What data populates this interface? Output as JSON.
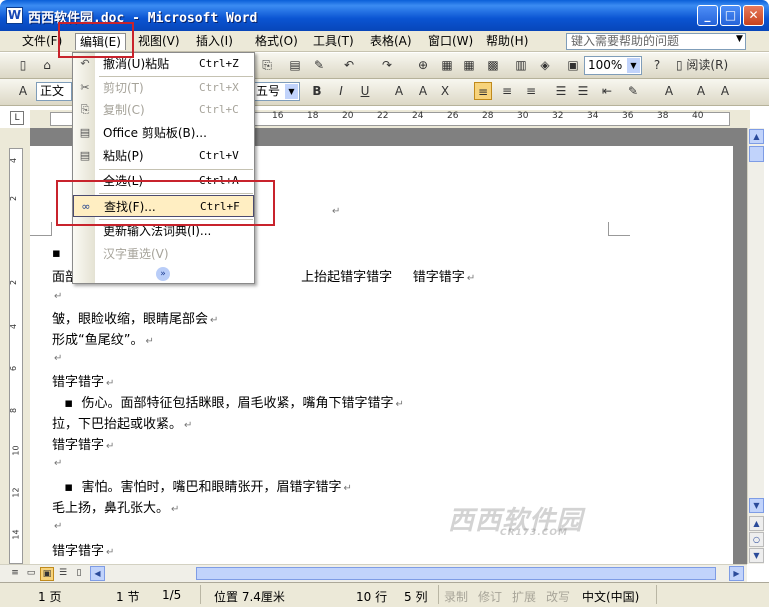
{
  "window": {
    "title": "西西软件园.doc - Microsoft Word",
    "app_icon_letter": "W"
  },
  "window_controls": {
    "minimize": "_",
    "maximize": "□",
    "close": "✕"
  },
  "menubar": {
    "items": [
      "文件(F)",
      "编辑(E)",
      "视图(V)",
      "插入(I)",
      "格式(O)",
      "工具(T)",
      "表格(A)",
      "窗口(W)",
      "帮助(H)"
    ],
    "help_placeholder": "键入需要帮助的问题"
  },
  "toolbar": {
    "zoom": "100%",
    "read_label": "阅读(R)",
    "style_value": "正文",
    "font_size": "五号"
  },
  "edit_menu": {
    "items": [
      {
        "icon": "undo-icon",
        "label": "撤消(U)粘贴",
        "shortcut": "Ctrl+Z"
      },
      {
        "icon": "cut-icon",
        "label": "剪切(T)",
        "shortcut": "Ctrl+X"
      },
      {
        "icon": "copy-icon",
        "label": "复制(C)",
        "shortcut": "Ctrl+C"
      },
      {
        "icon": "clipboard-icon",
        "label": "Office 剪贴板(B)...",
        "shortcut": ""
      },
      {
        "icon": "paste-icon",
        "label": "粘贴(P)",
        "shortcut": "Ctrl+V"
      },
      {
        "icon": "",
        "label": "全选(L)",
        "shortcut": "Ctrl+A"
      },
      {
        "icon": "binoculars-icon",
        "label": "查找(F)...",
        "shortcut": "Ctrl+F"
      },
      {
        "icon": "",
        "label": "更新输入法词典(I)...",
        "shortcut": ""
      },
      {
        "icon": "",
        "label": "汉字重选(V)",
        "shortcut": ""
      }
    ],
    "expand_glyph": "»"
  },
  "ruler": {
    "h_ticks": [
      "16",
      "18",
      "20",
      "22",
      "24",
      "26",
      "28",
      "30",
      "32",
      "34",
      "36",
      "38",
      "40"
    ],
    "v_ticks": [
      "4",
      "2",
      "2",
      "4",
      "6",
      "8",
      "10",
      "12",
      "14"
    ]
  },
  "document": {
    "lines": [
      "▪",
      "面部                                                      上抬起错字错字     错字错字",
      "",
      "皱，眼睑收缩，眼睛尾部会",
      "形成“鱼尾纹”。",
      "",
      "错字错字",
      "   ▪  伤心。面部特征包括眯眼，眉毛收紧，嘴角下错字错字",
      "拉，下巴抬起或收紧。",
      "错字错字",
      "",
      "   ▪  害怕。害怕时，嘴巴和眼睛张开，眉错字错字",
      "毛上扬，鼻孔张大。",
      "",
      "错字错字"
    ],
    "para_mark": "↵"
  },
  "statusbar": {
    "page": "1 页",
    "section": "1 节",
    "pages": "1/5",
    "position": "位置 7.4厘米",
    "line": "10 行",
    "col": "5 列",
    "rec": "录制",
    "trk": "修订",
    "ext": "扩展",
    "ovr": "改写",
    "lang": "中文(中国)"
  },
  "watermark": {
    "text": "西西软件园",
    "sub": "CR173.COM"
  }
}
